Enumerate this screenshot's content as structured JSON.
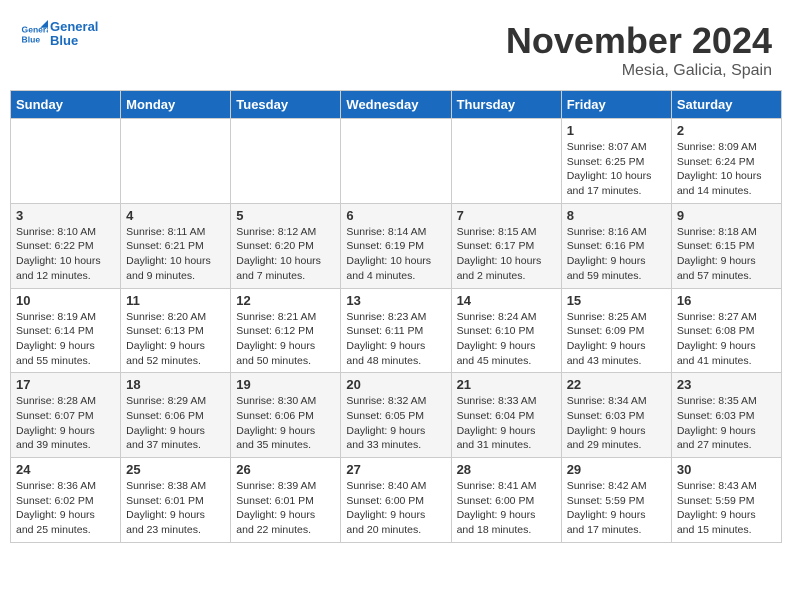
{
  "header": {
    "logo_line1": "General",
    "logo_line2": "Blue",
    "month": "November 2024",
    "location": "Mesia, Galicia, Spain"
  },
  "days_of_week": [
    "Sunday",
    "Monday",
    "Tuesday",
    "Wednesday",
    "Thursday",
    "Friday",
    "Saturday"
  ],
  "weeks": [
    [
      {
        "day": "",
        "info": ""
      },
      {
        "day": "",
        "info": ""
      },
      {
        "day": "",
        "info": ""
      },
      {
        "day": "",
        "info": ""
      },
      {
        "day": "",
        "info": ""
      },
      {
        "day": "1",
        "info": "Sunrise: 8:07 AM\nSunset: 6:25 PM\nDaylight: 10 hours and 17 minutes."
      },
      {
        "day": "2",
        "info": "Sunrise: 8:09 AM\nSunset: 6:24 PM\nDaylight: 10 hours and 14 minutes."
      }
    ],
    [
      {
        "day": "3",
        "info": "Sunrise: 8:10 AM\nSunset: 6:22 PM\nDaylight: 10 hours and 12 minutes."
      },
      {
        "day": "4",
        "info": "Sunrise: 8:11 AM\nSunset: 6:21 PM\nDaylight: 10 hours and 9 minutes."
      },
      {
        "day": "5",
        "info": "Sunrise: 8:12 AM\nSunset: 6:20 PM\nDaylight: 10 hours and 7 minutes."
      },
      {
        "day": "6",
        "info": "Sunrise: 8:14 AM\nSunset: 6:19 PM\nDaylight: 10 hours and 4 minutes."
      },
      {
        "day": "7",
        "info": "Sunrise: 8:15 AM\nSunset: 6:17 PM\nDaylight: 10 hours and 2 minutes."
      },
      {
        "day": "8",
        "info": "Sunrise: 8:16 AM\nSunset: 6:16 PM\nDaylight: 9 hours and 59 minutes."
      },
      {
        "day": "9",
        "info": "Sunrise: 8:18 AM\nSunset: 6:15 PM\nDaylight: 9 hours and 57 minutes."
      }
    ],
    [
      {
        "day": "10",
        "info": "Sunrise: 8:19 AM\nSunset: 6:14 PM\nDaylight: 9 hours and 55 minutes."
      },
      {
        "day": "11",
        "info": "Sunrise: 8:20 AM\nSunset: 6:13 PM\nDaylight: 9 hours and 52 minutes."
      },
      {
        "day": "12",
        "info": "Sunrise: 8:21 AM\nSunset: 6:12 PM\nDaylight: 9 hours and 50 minutes."
      },
      {
        "day": "13",
        "info": "Sunrise: 8:23 AM\nSunset: 6:11 PM\nDaylight: 9 hours and 48 minutes."
      },
      {
        "day": "14",
        "info": "Sunrise: 8:24 AM\nSunset: 6:10 PM\nDaylight: 9 hours and 45 minutes."
      },
      {
        "day": "15",
        "info": "Sunrise: 8:25 AM\nSunset: 6:09 PM\nDaylight: 9 hours and 43 minutes."
      },
      {
        "day": "16",
        "info": "Sunrise: 8:27 AM\nSunset: 6:08 PM\nDaylight: 9 hours and 41 minutes."
      }
    ],
    [
      {
        "day": "17",
        "info": "Sunrise: 8:28 AM\nSunset: 6:07 PM\nDaylight: 9 hours and 39 minutes."
      },
      {
        "day": "18",
        "info": "Sunrise: 8:29 AM\nSunset: 6:06 PM\nDaylight: 9 hours and 37 minutes."
      },
      {
        "day": "19",
        "info": "Sunrise: 8:30 AM\nSunset: 6:06 PM\nDaylight: 9 hours and 35 minutes."
      },
      {
        "day": "20",
        "info": "Sunrise: 8:32 AM\nSunset: 6:05 PM\nDaylight: 9 hours and 33 minutes."
      },
      {
        "day": "21",
        "info": "Sunrise: 8:33 AM\nSunset: 6:04 PM\nDaylight: 9 hours and 31 minutes."
      },
      {
        "day": "22",
        "info": "Sunrise: 8:34 AM\nSunset: 6:03 PM\nDaylight: 9 hours and 29 minutes."
      },
      {
        "day": "23",
        "info": "Sunrise: 8:35 AM\nSunset: 6:03 PM\nDaylight: 9 hours and 27 minutes."
      }
    ],
    [
      {
        "day": "24",
        "info": "Sunrise: 8:36 AM\nSunset: 6:02 PM\nDaylight: 9 hours and 25 minutes."
      },
      {
        "day": "25",
        "info": "Sunrise: 8:38 AM\nSunset: 6:01 PM\nDaylight: 9 hours and 23 minutes."
      },
      {
        "day": "26",
        "info": "Sunrise: 8:39 AM\nSunset: 6:01 PM\nDaylight: 9 hours and 22 minutes."
      },
      {
        "day": "27",
        "info": "Sunrise: 8:40 AM\nSunset: 6:00 PM\nDaylight: 9 hours and 20 minutes."
      },
      {
        "day": "28",
        "info": "Sunrise: 8:41 AM\nSunset: 6:00 PM\nDaylight: 9 hours and 18 minutes."
      },
      {
        "day": "29",
        "info": "Sunrise: 8:42 AM\nSunset: 5:59 PM\nDaylight: 9 hours and 17 minutes."
      },
      {
        "day": "30",
        "info": "Sunrise: 8:43 AM\nSunset: 5:59 PM\nDaylight: 9 hours and 15 minutes."
      }
    ]
  ]
}
